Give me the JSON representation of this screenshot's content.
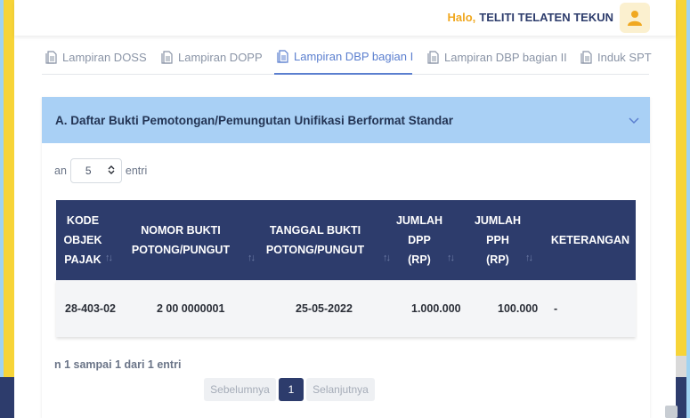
{
  "header": {
    "greeting": "Halo,",
    "user_name": "TELITI TELATEN TEKUN",
    "avatar_icon": "user-icon"
  },
  "tabs": [
    {
      "label": "Lampiran DOSS",
      "icon": "document-icon",
      "active": false
    },
    {
      "label": "Lampiran DOPP",
      "icon": "document-icon",
      "active": false
    },
    {
      "label": "Lampiran DBP bagian I",
      "icon": "document-icon",
      "active": true
    },
    {
      "label": "Lampiran DBP bagian II",
      "icon": "document-icon",
      "active": false
    },
    {
      "label": "Induk SPT",
      "icon": "document-icon",
      "active": false
    }
  ],
  "section": {
    "title": "A. Daftar Bukti Pemotongan/Pemungutan Unifikasi Berformat Standar",
    "length_prefix": "an",
    "length_value": "5",
    "length_suffix": "entri",
    "columns": [
      {
        "lines": [
          "KODE",
          "OBJEK",
          "PAJAK"
        ]
      },
      {
        "lines": [
          "NOMOR BUKTI",
          "POTONG/PUNGUT"
        ]
      },
      {
        "lines": [
          "TANGGAL BUKTI",
          "POTONG/PUNGUT"
        ]
      },
      {
        "lines": [
          "JUMLAH",
          "DPP",
          "(RP)"
        ]
      },
      {
        "lines": [
          "JUMLAH",
          "PPH",
          "(RP)"
        ]
      },
      {
        "lines": [
          "KETERANGAN"
        ]
      }
    ],
    "rows": [
      [
        "28-403-02",
        "2 00 0000001",
        "25-05-2022",
        "1.000.000",
        "100.000",
        "-"
      ]
    ],
    "info": "n 1 sampai 1 dari 1 entri",
    "pagination": {
      "prev": "Sebelumnya",
      "current": "1",
      "next": "Selanjutnya"
    }
  },
  "colors": {
    "accent": "#2d3c6c",
    "header_band": "#a9d0f5",
    "active_tab": "#5b7fcf",
    "greeting": "#f0a820",
    "side_band": "#f7d438"
  }
}
